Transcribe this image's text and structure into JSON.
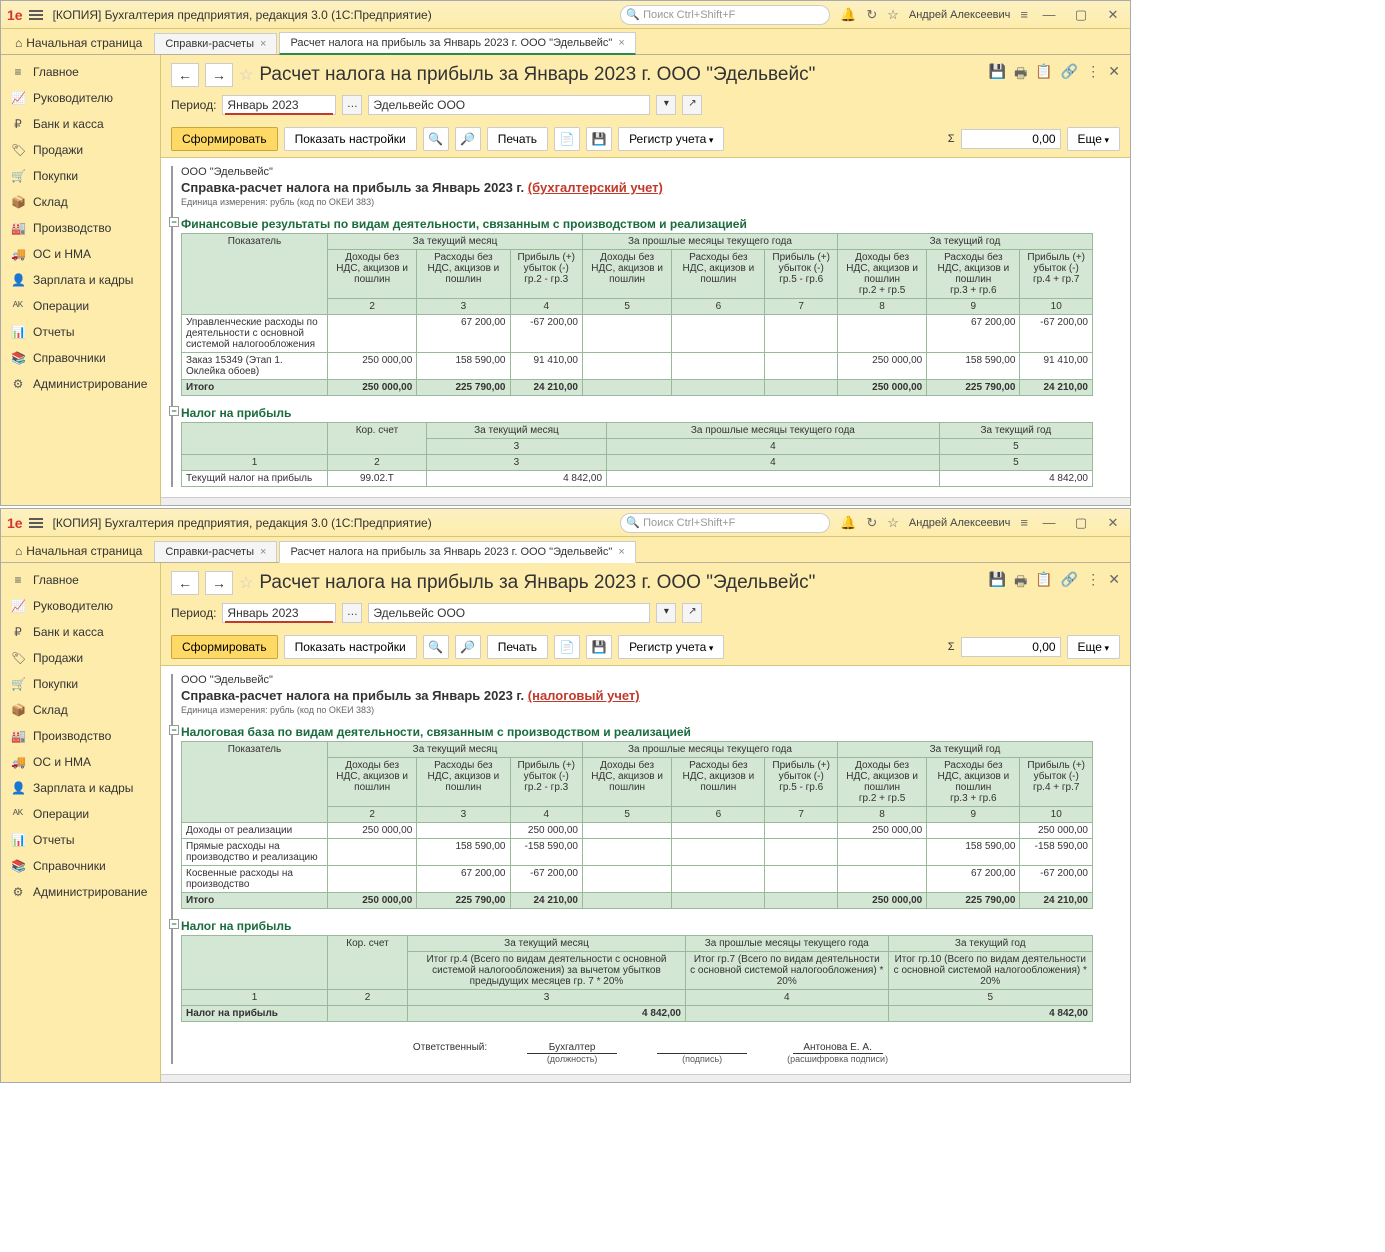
{
  "app": {
    "title": "[КОПИЯ] Бухгалтерия предприятия, редакция 3.0  (1С:Предприятие)",
    "search_placeholder": "Поиск Ctrl+Shift+F",
    "user": "Андрей Алексеевич"
  },
  "tabs": {
    "home": "Начальная страница",
    "t1": "Справки-расчеты",
    "t2": "Расчет налога на прибыль за Январь 2023 г. ООО \"Эдельвейс\""
  },
  "nav": [
    "Главное",
    "Руководителю",
    "Банк и касса",
    "Продажи",
    "Покупки",
    "Склад",
    "Производство",
    "ОС и НМА",
    "Зарплата и кадры",
    "Операции",
    "Отчеты",
    "Справочники",
    "Администрирование"
  ],
  "nav_icons": [
    "★",
    "📈",
    "₽",
    "🏷",
    "🛒",
    "📦",
    "🏭",
    "🚚",
    "👤",
    "ᴬᴷ",
    "📊",
    "📚",
    "⚙"
  ],
  "page": {
    "title": "Расчет налога на прибыль за Январь 2023 г. ООО \"Эдельвейс\"",
    "period_lbl": "Период:",
    "period_val": "Январь 2023",
    "org_val": "Эдельвейс ООО"
  },
  "toolbar": {
    "form": "Сформировать",
    "settings": "Показать настройки",
    "print": "Печать",
    "register": "Регистр учета",
    "more": "Еще",
    "sum": "0,00"
  },
  "rep": {
    "org": "ООО \"Эдельвейс\"",
    "title_pre": "Справка-расчет налога на прибыль за Январь 2023 г.",
    "paren1": "(бухгалтерский учет)",
    "paren2": "(налоговый учет)",
    "unit": "Единица измерения: рубль (код по ОКЕИ 383)",
    "sec1a": "Финансовые результаты по видам деятельности, связанным с производством и реализацией",
    "sec1b": "Налоговая база по видам деятельности, связанным с производством и реализацией",
    "sec2": "Налог на прибыль",
    "h_pokaz": "Показатель",
    "h_cur_m": "За текущий месяц",
    "h_prev_m": "За прошлые месяцы текущего года",
    "h_year": "За текущий год",
    "h_inc": "Доходы без НДС, акцизов и пошлин",
    "h_exp": "Расходы без НДС, акцизов и пошлин",
    "h_prof": "Прибыль (+) убыток (-)",
    "h_g23": "гр.2 - гр.3",
    "h_g56": "гр.5 - гр.6",
    "h_g25": "гр.2 + гр.5",
    "h_g36": "гр.3 + гр.6",
    "h_g47": "гр.4 + гр.7",
    "h_kor": "Кор. счет",
    "row1a_1": "Управленческие расходы по деятельности с основной системой налогообложения",
    "row1a_2": "Заказ 15349 (Этап 1. Оклейка обоев)",
    "row1b_1": "Доходы от реализации",
    "row1b_2": "Прямые расходы на производство и реализацию",
    "row1b_3": "Косвенные расходы на производство",
    "itogo": "Итого",
    "tax_row": "Текущий налог на прибыль",
    "tax_row2": "Налог на прибыль",
    "kor_val": "99.02.Т",
    "h_itog4": "Итог гр.4 (Всего по видам деятельности с основной системой налогообложения) за вычетом убытков предыдущих месяцев гр. 7 * 20%",
    "h_itog7": "Итог гр.7 (Всего по видам деятельности с основной системой налогообложения) * 20%",
    "h_itog10": "Итог гр.10 (Всего по видам деятельности с основной системой налогообложения) * 20%",
    "resp": "Ответственный:",
    "pos": "Бухгалтер",
    "pos_sub": "(должность)",
    "sign_sub": "(подпись)",
    "name": "Антонова Е. А.",
    "name_sub": "(расшифровка подписи)"
  },
  "chart_data": {
    "type": "table",
    "top_table_rows": [
      {
        "label": "Управленческие расходы по деятельности с основной системой налогообложения",
        "c2": "",
        "c3": "67 200,00",
        "c4": "-67 200,00",
        "c5": "",
        "c6": "",
        "c7": "",
        "c8": "",
        "c9": "67 200,00",
        "c10": "-67 200,00"
      },
      {
        "label": "Заказ 15349 (Этап 1. Оклейка обоев)",
        "c2": "250 000,00",
        "c3": "158 590,00",
        "c4": "91 410,00",
        "c5": "",
        "c6": "",
        "c7": "",
        "c8": "250 000,00",
        "c9": "158 590,00",
        "c10": "91 410,00"
      },
      {
        "label": "Итого",
        "c2": "250 000,00",
        "c3": "225 790,00",
        "c4": "24 210,00",
        "c5": "",
        "c6": "",
        "c7": "",
        "c8": "250 000,00",
        "c9": "225 790,00",
        "c10": "24 210,00"
      }
    ],
    "bottom_table_rows": [
      {
        "label": "Доходы от реализации",
        "c2": "250 000,00",
        "c3": "",
        "c4": "250 000,00",
        "c5": "",
        "c6": "",
        "c7": "",
        "c8": "250 000,00",
        "c9": "",
        "c10": "250 000,00"
      },
      {
        "label": "Прямые расходы на производство и реализацию",
        "c2": "",
        "c3": "158 590,00",
        "c4": "-158 590,00",
        "c5": "",
        "c6": "",
        "c7": "",
        "c8": "",
        "c9": "158 590,00",
        "c10": "-158 590,00"
      },
      {
        "label": "Косвенные расходы на производство",
        "c2": "",
        "c3": "67 200,00",
        "c4": "-67 200,00",
        "c5": "",
        "c6": "",
        "c7": "",
        "c8": "",
        "c9": "67 200,00",
        "c10": "-67 200,00"
      },
      {
        "label": "Итого",
        "c2": "250 000,00",
        "c3": "225 790,00",
        "c4": "24 210,00",
        "c5": "",
        "c6": "",
        "c7": "",
        "c8": "250 000,00",
        "c9": "225 790,00",
        "c10": "24 210,00"
      }
    ],
    "tax_value": "4 842,00"
  }
}
